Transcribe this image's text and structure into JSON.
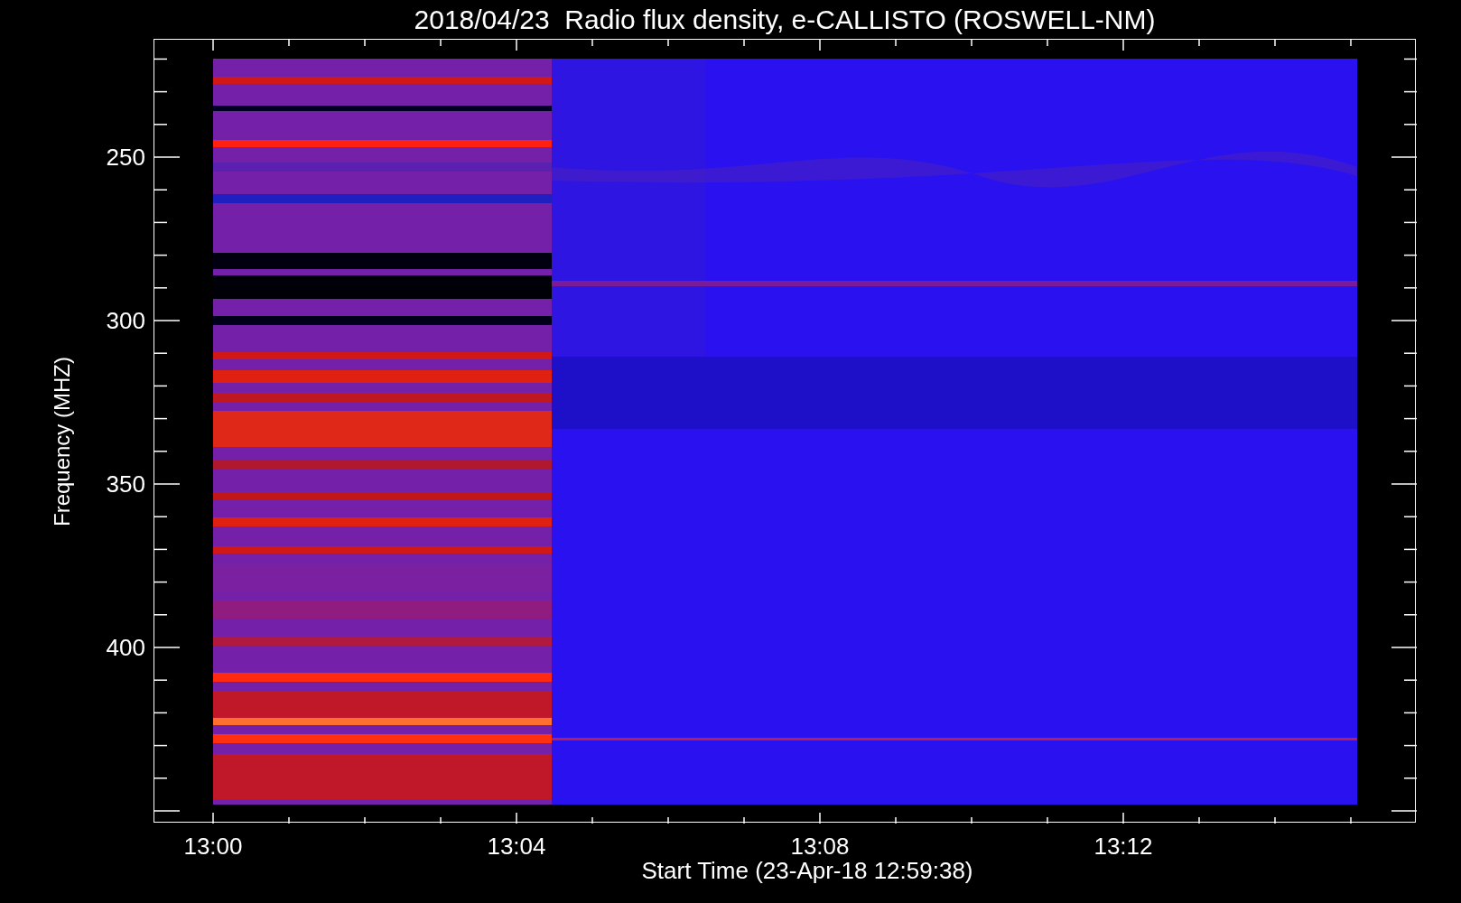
{
  "title": "2018/04/23  Radio flux density, e-CALLISTO (ROSWELL-NM)",
  "y_axis": {
    "label": "Frequency (MHZ)",
    "ticks": [
      "250",
      "300",
      "350",
      "400"
    ]
  },
  "x_axis": {
    "label": "Start Time (23-Apr-18 12:59:38)",
    "ticks": [
      "13:00",
      "13:04",
      "13:08",
      "13:12"
    ]
  }
}
